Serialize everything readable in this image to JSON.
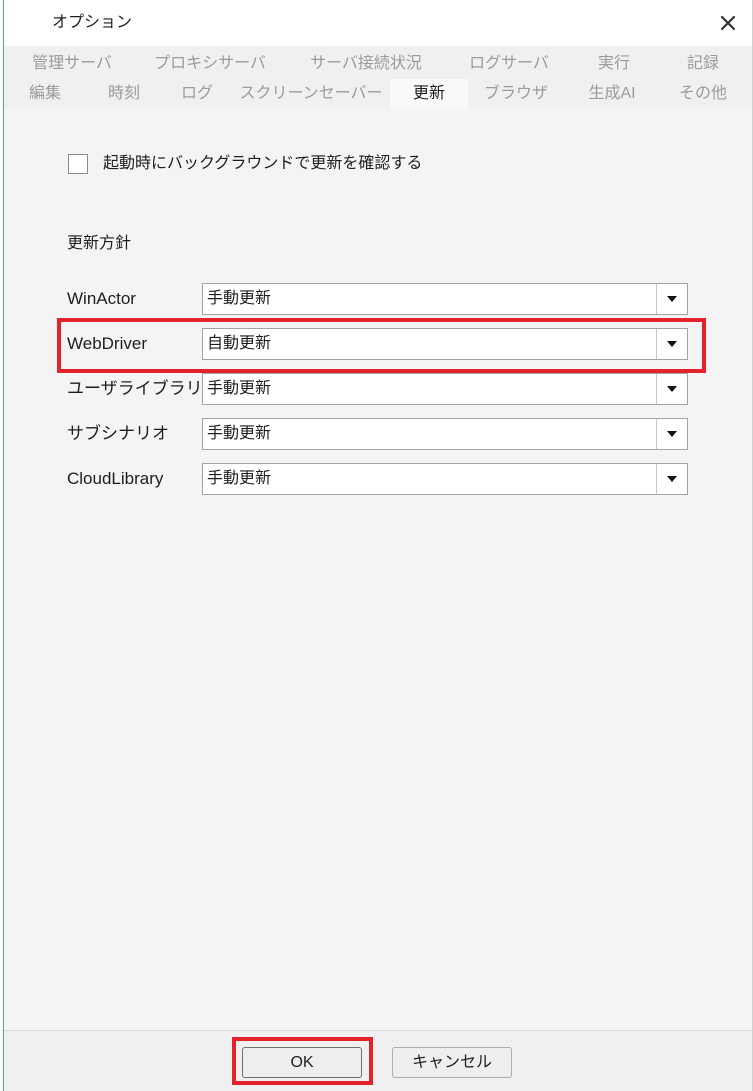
{
  "window": {
    "title": "オプション"
  },
  "icons": {
    "close": "close-icon",
    "dropdown_arrow": "triangle-down-icon"
  },
  "colors": {
    "highlight": "#e3232b",
    "window_edge": "#5b9bd5",
    "inactive_tab_text": "#9b9b9b"
  },
  "tabs": {
    "row1": [
      {
        "label": "管理サーバ",
        "selected": false
      },
      {
        "label": "プロキシサーバ",
        "selected": false
      },
      {
        "label": "サーバ接続状況",
        "selected": false
      },
      {
        "label": "ログサーバ",
        "selected": false
      },
      {
        "label": "実行",
        "selected": false
      },
      {
        "label": "記録",
        "selected": false
      }
    ],
    "row2": [
      {
        "label": "編集",
        "selected": false
      },
      {
        "label": "時刻",
        "selected": false
      },
      {
        "label": "ログ",
        "selected": false
      },
      {
        "label": "スクリーンセーバー",
        "selected": false
      },
      {
        "label": "更新",
        "selected": true
      },
      {
        "label": "ブラウザ",
        "selected": false
      },
      {
        "label": "生成AI",
        "selected": false
      },
      {
        "label": "その他",
        "selected": false
      }
    ]
  },
  "update_settings": {
    "startup_check": {
      "label": "起動時にバックグラウンドで更新を確認する",
      "checked": false
    },
    "policy_heading": "更新方針",
    "policies": [
      {
        "label": "WinActor",
        "value": "手動更新",
        "highlighted": false
      },
      {
        "label": "WebDriver",
        "value": "自動更新",
        "highlighted": true
      },
      {
        "label": "ユーザライブラリ",
        "value": "手動更新",
        "highlighted": false
      },
      {
        "label": "サブシナリオ",
        "value": "手動更新",
        "highlighted": false
      },
      {
        "label": "CloudLibrary",
        "value": "手動更新",
        "highlighted": false
      }
    ]
  },
  "footer": {
    "ok_label": "OK",
    "cancel_label": "キャンセル",
    "ok_highlighted": true
  }
}
